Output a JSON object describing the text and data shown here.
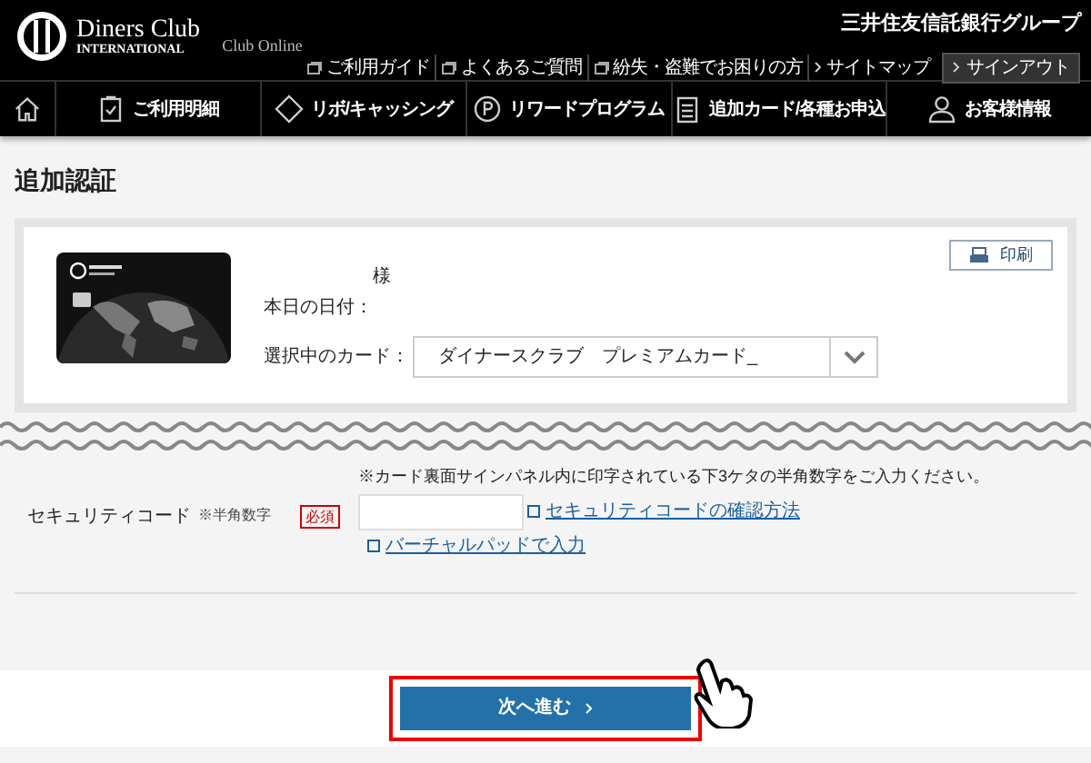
{
  "header": {
    "logo_line1": "Diners Club",
    "logo_line2": "INTERNATIONAL",
    "service": "Club Online",
    "group": "三井住友信託銀行グループ",
    "links": [
      {
        "label": "ご利用ガイド",
        "kind": "doc"
      },
      {
        "label": "よくあるご質問",
        "kind": "doc"
      },
      {
        "label": "紛失・盗難でお困りの方",
        "kind": "doc"
      },
      {
        "label": "サイトマップ",
        "kind": "arrow"
      }
    ],
    "signout": "サインアウト"
  },
  "nav": [
    {
      "label": "ご利用明細",
      "kind": "clipboard"
    },
    {
      "label": "リボ/キャッシング",
      "kind": "diamond"
    },
    {
      "label": "リワードプログラム",
      "kind": "points"
    },
    {
      "label": "追加カード/各種お申込",
      "kind": "form"
    },
    {
      "label": "お客様情報",
      "kind": "person"
    }
  ],
  "page_title": "追加認証",
  "card_panel": {
    "print": "印刷",
    "honorific": "様",
    "date_label": "本日の日付：",
    "card_label": "選択中のカード：",
    "card_select": "ダイナースクラブ　プレミアムカード_"
  },
  "security": {
    "note": "※カード裏面サインパネル内に印字されている下3ケタの半角数字をご入力ください。",
    "label": "セキュリティコード",
    "sub_label": "※半角数字",
    "required": "必須",
    "help_link": "セキュリティコードの確認方法",
    "pad_link": "バーチャルパッドで入力"
  },
  "next_button": "次へ進む",
  "highlighted": true
}
